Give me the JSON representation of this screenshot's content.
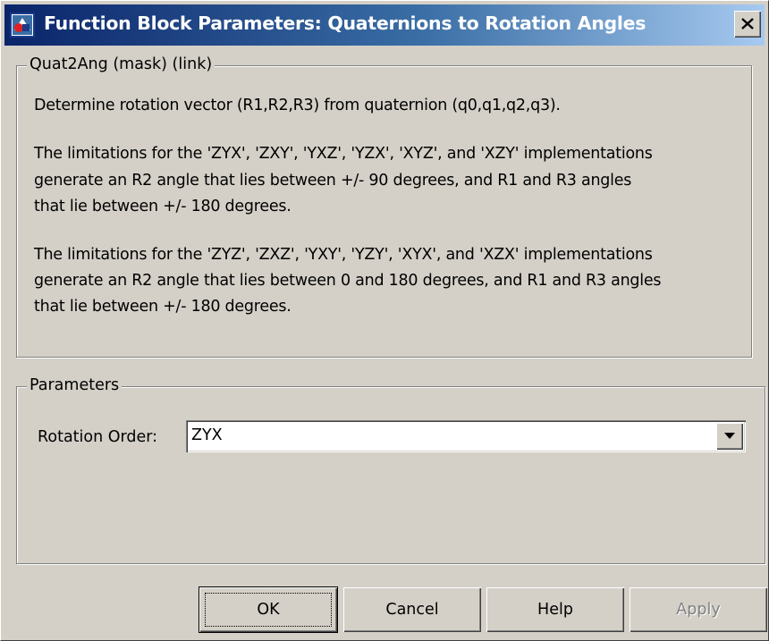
{
  "window": {
    "title": "Function Block Parameters: Quaternions to Rotation Angles",
    "close_icon": "close-icon",
    "app_icon": "simulink-block-icon"
  },
  "description_group": {
    "legend": "Quat2Ang (mask) (link)",
    "lines": [
      "Determine rotation vector (R1,R2,R3) from quaternion (q0,q1,q2,q3).",
      "The limitations for the 'ZYX', 'ZXY', 'YXZ', 'YZX', 'XYZ', and 'XZY' implementations",
      "generate an R2 angle that lies between +/- 90 degrees, and R1 and R3 angles",
      "that lie between +/- 180 degrees.",
      "The limitations for the 'ZYZ', 'ZXZ', 'YXY', 'YZY', 'XYX', and 'XZX' implementations",
      "generate an R2 angle that lies between 0 and 180 degrees, and R1 and R3 angles",
      "that lie between +/- 180 degrees."
    ]
  },
  "parameters_group": {
    "legend": "Parameters",
    "rotation_order": {
      "label": "Rotation Order:",
      "value": "ZYX"
    }
  },
  "buttons": {
    "ok": "OK",
    "cancel": "Cancel",
    "help": "Help",
    "apply": "Apply"
  },
  "colors": {
    "face": "#d4d0c8",
    "title_start": "#0a246a",
    "title_end": "#a6caf0",
    "disabled_text": "#808080"
  }
}
